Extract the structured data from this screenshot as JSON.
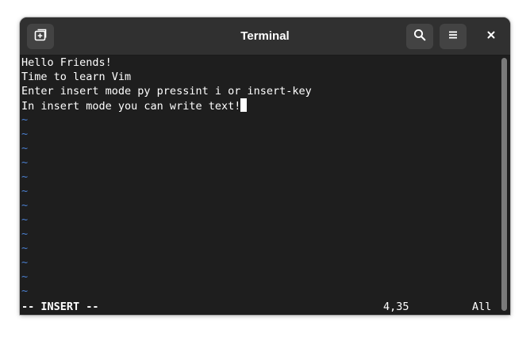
{
  "window": {
    "title": "Terminal"
  },
  "headerbar": {
    "new_tab_icon": "new-tab-icon",
    "search_icon": "search-icon",
    "menu_icon": "hamburger-menu-icon",
    "close_icon": "close-icon"
  },
  "terminal": {
    "lines": [
      "Hello Friends!",
      "Time to learn Vim",
      "Enter insert mode py pressint i or insert-key",
      "In insert mode you can write text!"
    ],
    "empty_line_marker": "~",
    "status": {
      "mode": "-- INSERT --",
      "position": "4,35",
      "scroll": "All"
    }
  },
  "colors": {
    "background": "#1e1e1e",
    "headerbar": "#303030",
    "text": "#ffffff",
    "tilde": "#4a7fd0"
  }
}
